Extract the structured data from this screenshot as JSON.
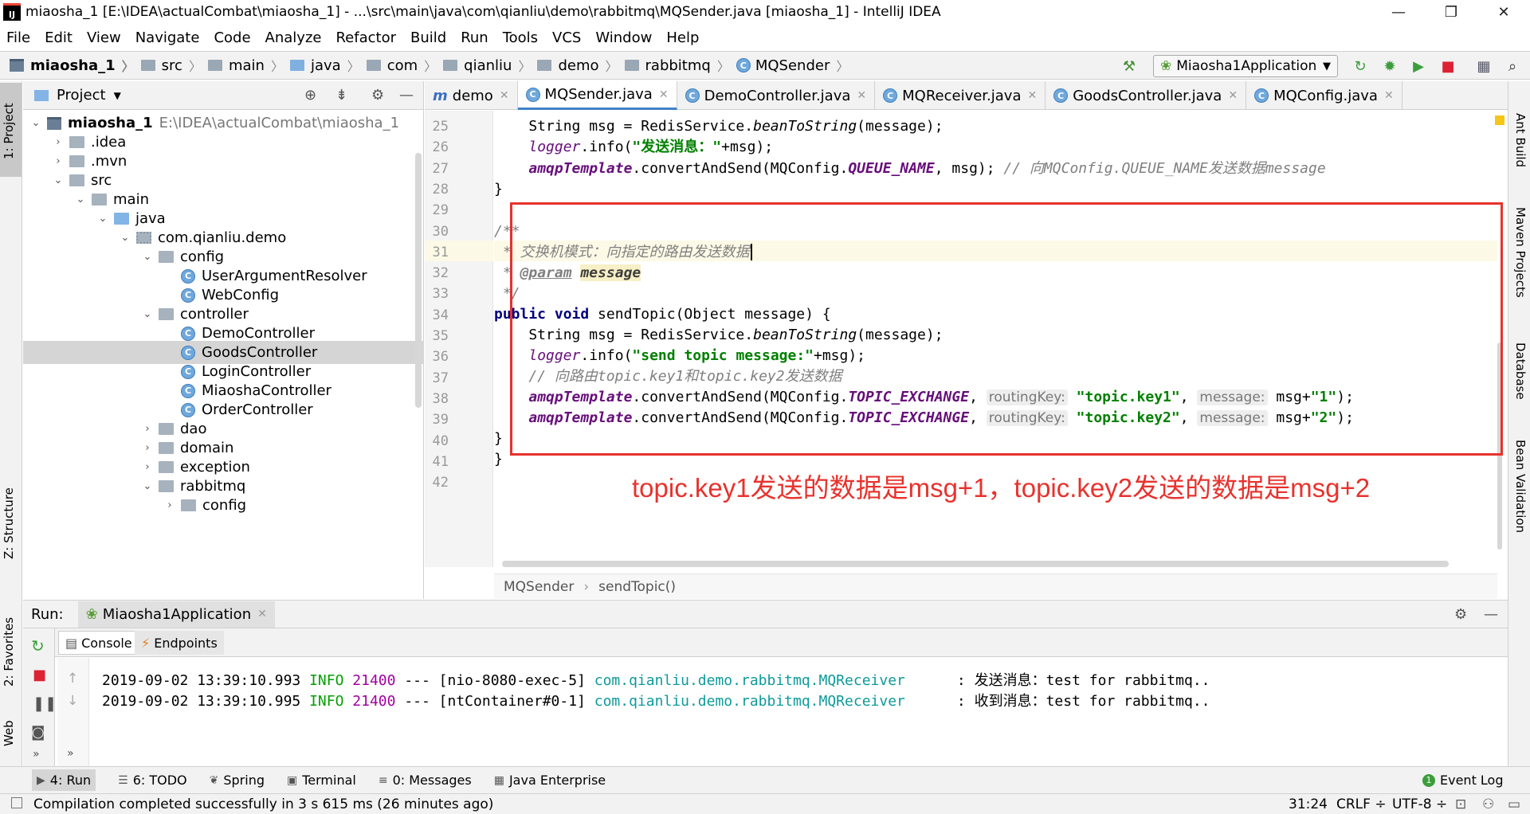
{
  "window": {
    "title": "miaosha_1 [E:\\IDEA\\actualCombat\\miaosha_1] - ...\\src\\main\\java\\com\\qianliu\\demo\\rabbitmq\\MQSender.java [miaosha_1] - IntelliJ IDEA",
    "min": "—",
    "max": "❐",
    "close": "✕"
  },
  "menu": [
    "File",
    "Edit",
    "View",
    "Navigate",
    "Code",
    "Analyze",
    "Refactor",
    "Build",
    "Run",
    "Tools",
    "VCS",
    "Window",
    "Help"
  ],
  "nav": {
    "crumbs": [
      "miaosha_1",
      "src",
      "main",
      "java",
      "com",
      "qianliu",
      "demo",
      "rabbitmq",
      "MQSender"
    ],
    "run_config": "Miaosha1Application"
  },
  "left_strip": {
    "project": "1: Project",
    "structure": "Z: Structure",
    "favorites": "2: Favorites",
    "web": "Web"
  },
  "right_strip": {
    "ant": "Ant Build",
    "maven": "Maven Projects",
    "database": "Database",
    "bean": "Bean Validation"
  },
  "project_panel": {
    "title": "Project",
    "tree": [
      {
        "label": "miaosha_1",
        "path": "E:\\IDEA\\actualCombat\\miaosha_1",
        "arrow": "⌄",
        "indent": 0,
        "icon": "project"
      },
      {
        "label": ".idea",
        "arrow": "›",
        "indent": 1,
        "icon": "folder"
      },
      {
        "label": ".mvn",
        "arrow": "›",
        "indent": 1,
        "icon": "folder"
      },
      {
        "label": "src",
        "arrow": "⌄",
        "indent": 1,
        "icon": "folder"
      },
      {
        "label": "main",
        "arrow": "⌄",
        "indent": 2,
        "icon": "folder"
      },
      {
        "label": "java",
        "arrow": "⌄",
        "indent": 3,
        "icon": "folder-blue"
      },
      {
        "label": "com.qianliu.demo",
        "arrow": "⌄",
        "indent": 4,
        "icon": "package"
      },
      {
        "label": "config",
        "arrow": "⌄",
        "indent": 5,
        "icon": "folder"
      },
      {
        "label": "UserArgumentResolver",
        "arrow": "",
        "indent": 6,
        "icon": "class"
      },
      {
        "label": "WebConfig",
        "arrow": "",
        "indent": 6,
        "icon": "class"
      },
      {
        "label": "controller",
        "arrow": "⌄",
        "indent": 5,
        "icon": "folder"
      },
      {
        "label": "DemoController",
        "arrow": "",
        "indent": 6,
        "icon": "class"
      },
      {
        "label": "GoodsController",
        "arrow": "",
        "indent": 6,
        "icon": "class",
        "selected": true
      },
      {
        "label": "LoginController",
        "arrow": "",
        "indent": 6,
        "icon": "class"
      },
      {
        "label": "MiaoshaController",
        "arrow": "",
        "indent": 6,
        "icon": "class"
      },
      {
        "label": "OrderController",
        "arrow": "",
        "indent": 6,
        "icon": "class"
      },
      {
        "label": "dao",
        "arrow": "›",
        "indent": 5,
        "icon": "folder"
      },
      {
        "label": "domain",
        "arrow": "›",
        "indent": 5,
        "icon": "folder"
      },
      {
        "label": "exception",
        "arrow": "›",
        "indent": 5,
        "icon": "folder"
      },
      {
        "label": "rabbitmq",
        "arrow": "⌄",
        "indent": 5,
        "icon": "folder"
      },
      {
        "label": "config",
        "arrow": "›",
        "indent": 6,
        "icon": "folder"
      }
    ]
  },
  "tabs": [
    {
      "label": "demo",
      "icon": "m",
      "active": false
    },
    {
      "label": "MQSender.java",
      "icon": "c",
      "active": true
    },
    {
      "label": "DemoController.java",
      "icon": "c",
      "active": false
    },
    {
      "label": "MQReceiver.java",
      "icon": "c",
      "active": false
    },
    {
      "label": "GoodsController.java",
      "icon": "c",
      "active": false
    },
    {
      "label": "MQConfig.java",
      "icon": "c",
      "active": false
    }
  ],
  "editor": {
    "line_numbers": [
      "25",
      "26",
      "27",
      "28",
      "29",
      "30",
      "31",
      "32",
      "33",
      "34",
      "35",
      "36",
      "37",
      "38",
      "39",
      "40",
      "41",
      "42"
    ],
    "current_line": "31",
    "annotation": "topic.key1发送的数据是msg+1，topic.key2发送的数据是msg+2",
    "breadcrumb": [
      "MQSender",
      "sendTopic()"
    ]
  },
  "run": {
    "label": "Run:",
    "config": "Miaosha1Application",
    "tabs": [
      "Console",
      "Endpoints"
    ],
    "console": [
      {
        "ts": "2019-09-02 13:39:10.993",
        "level": "INFO",
        "pid": "21400",
        "thread": "--- [nio-8080-exec-5]",
        "logger": "com.qianliu.demo.rabbitmq.MQReceiver",
        "msg": "     : 发送消息：test for rabbitmq.."
      },
      {
        "ts": "2019-09-02 13:39:10.995",
        "level": "INFO",
        "pid": "21400",
        "thread": "--- [ntContainer#0-1]",
        "logger": "com.qianliu.demo.rabbitmq.MQReceiver",
        "msg": "     : 收到消息：test for rabbitmq.."
      }
    ]
  },
  "bottom_tools": [
    "4: Run",
    "6: TODO",
    "Spring",
    "Terminal",
    "0: Messages",
    "Java Enterprise"
  ],
  "event_log": "Event Log",
  "status": {
    "message": "Compilation completed successfully in 3 s 615 ms (26 minutes ago)",
    "position": "31:24",
    "line_sep": "CRLF ÷",
    "encoding": "UTF-8 ÷"
  }
}
